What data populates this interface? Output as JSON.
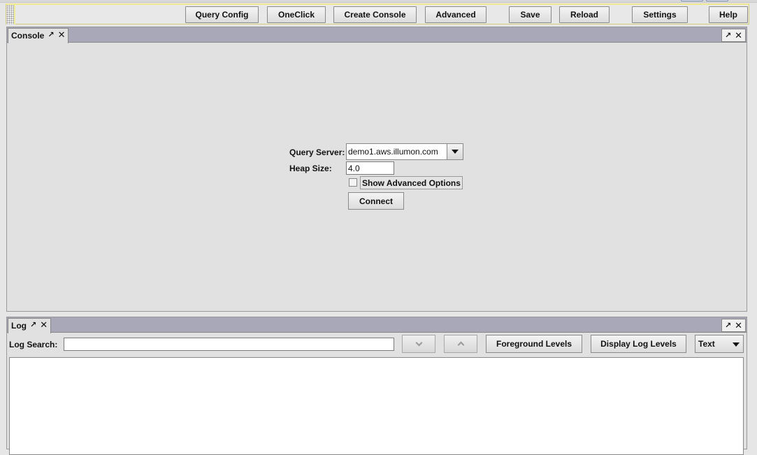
{
  "toolbar": {
    "query_config": "Query Config",
    "oneclick": "OneClick",
    "create_console": "Create Console",
    "advanced": "Advanced",
    "save": "Save",
    "reload": "Reload",
    "settings": "Settings",
    "help": "Help"
  },
  "console_panel": {
    "tab_label": "Console",
    "query_server_label": "Query Server:",
    "query_server_value": "demo1.aws.illumon.com",
    "heap_size_label": "Heap Size:",
    "heap_size_value": "4.0",
    "show_advanced_label": "Show Advanced Options",
    "show_advanced_checked": false,
    "connect_label": "Connect"
  },
  "log_panel": {
    "tab_label": "Log",
    "search_label": "Log Search:",
    "search_value": "",
    "foreground_levels": "Foreground Levels",
    "display_log_levels": "Display Log Levels",
    "format_value": "Text"
  },
  "icons": {
    "pin": "↗",
    "close": "✕"
  }
}
